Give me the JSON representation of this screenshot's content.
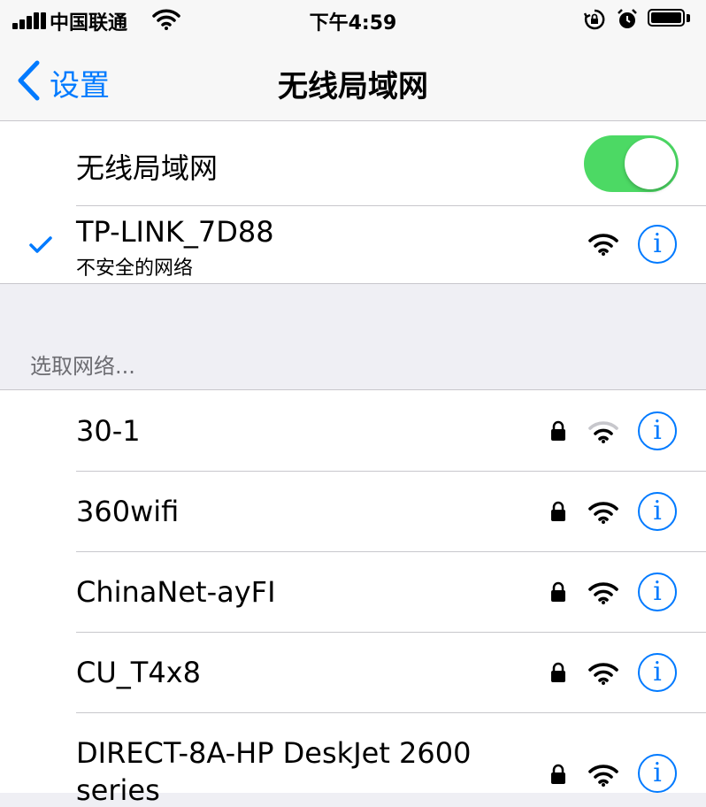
{
  "status_bar": {
    "carrier": "中国联通",
    "time": "下午4:59",
    "icons": [
      "signal-icon",
      "wifi-icon",
      "rotation-lock-icon",
      "alarm-icon",
      "battery-icon"
    ]
  },
  "nav": {
    "back_label": "设置",
    "title": "无线局域网"
  },
  "wifi_toggle": {
    "label": "无线局域网",
    "on": true,
    "accent_color": "#4cd964"
  },
  "connected": {
    "ssid": "TP-LINK_7D88",
    "note": "不安全的网络",
    "icons": [
      "checkmark-icon",
      "wifi-icon",
      "info-icon"
    ]
  },
  "section_header": "选取网络...",
  "networks": [
    {
      "ssid": "30-1",
      "locked": true,
      "signal": "weak"
    },
    {
      "ssid": "360wifi",
      "locked": true,
      "signal": "full"
    },
    {
      "ssid": "ChinaNet-ayFI",
      "locked": true,
      "signal": "full"
    },
    {
      "ssid": "CU_T4x8",
      "locked": true,
      "signal": "full"
    },
    {
      "ssid": "DIRECT-8A-HP DeskJet 2600",
      "ssid_line2": "series",
      "locked": true,
      "signal": "full"
    }
  ],
  "info_glyph": "i",
  "link_color": "#007aff"
}
